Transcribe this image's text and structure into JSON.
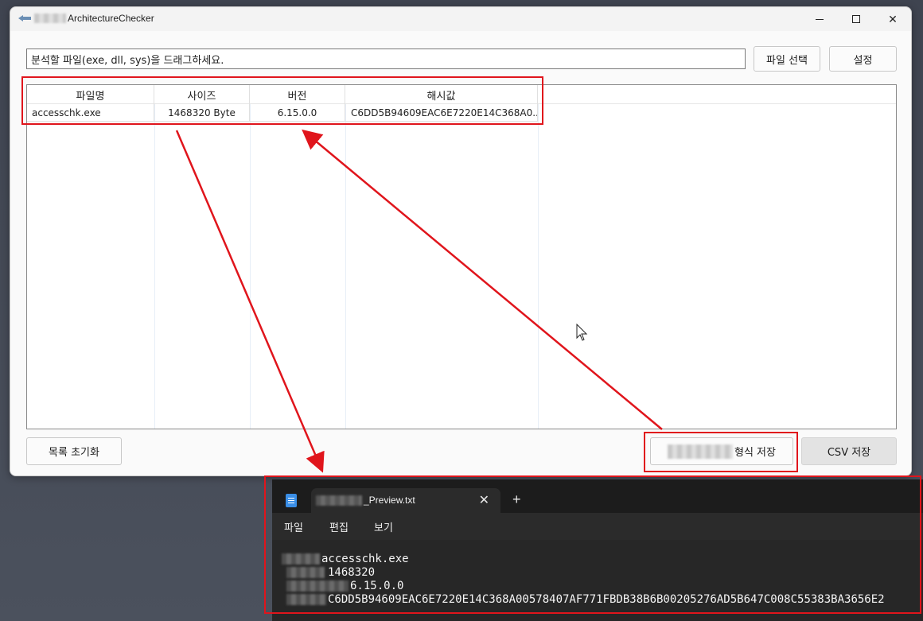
{
  "app": {
    "title": "ArchitectureChecker",
    "drop_placeholder": "분석할 파일(exe, dll, sys)을 드래그하세요.",
    "select_file_label": "파일 선택",
    "settings_label": "설정",
    "columns": [
      "파일명",
      "사이즈",
      "버전",
      "해시값"
    ],
    "rows": [
      {
        "name": "accesschk.exe",
        "size": "1468320 Byte",
        "version": "6.15.0.0",
        "hash": "C6DD5B94609EAC6E7220E14C368A0..."
      }
    ],
    "reset_label": "목록 초기화",
    "format_save_label": "형식 저장",
    "csv_save_label": "CSV 저장"
  },
  "notepad": {
    "tab_name": "_Preview.txt",
    "menu": [
      "파일",
      "편집",
      "보기"
    ],
    "lines": [
      "accesschk.exe",
      "1468320",
      "6.15.0.0",
      "C6DD5B94609EAC6E7220E14C368A00578407AF771FBDB38B6B00205276AD5B647C008C55383BA3656E2"
    ],
    "new_tab_symbol": "+",
    "close_symbol": "✕"
  },
  "colors": {
    "annotation": "#e0151c",
    "app_bg": "#fafafa",
    "notepad_bg": "#272727"
  }
}
